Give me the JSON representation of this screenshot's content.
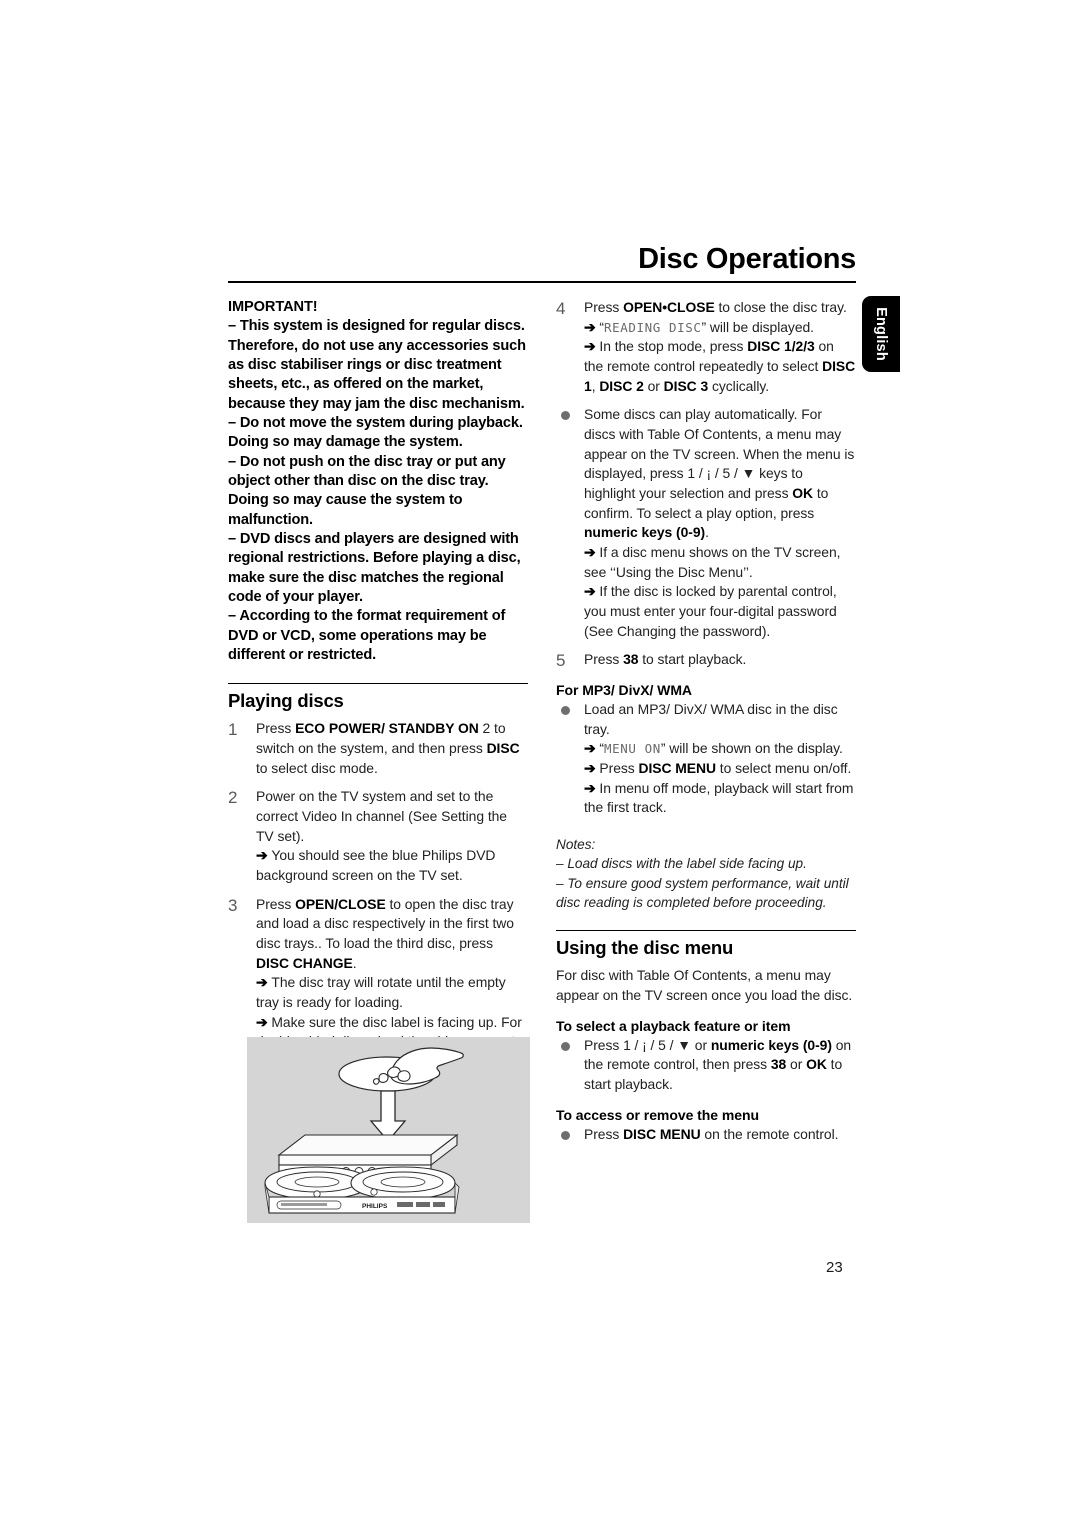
{
  "document": {
    "page_title": "Disc Operations",
    "language_tab": "English",
    "page_number": "23"
  },
  "left_column": {
    "important_heading": "IMPORTANT!",
    "important_items": [
      "This system is designed for regular discs. Therefore, do not use any accessories such as disc stabiliser rings or disc treatment sheets, etc., as offered on the market, because they may jam the disc mechanism.",
      "Do not move the system during playback. Doing so may damage the system.",
      "Do not push on the disc tray or put any object other than disc on the disc tray. Doing so may cause the system to malfunction.",
      "DVD discs and players are designed with regional restrictions. Before playing a disc, make sure the disc matches the regional code of your player.",
      "According to the format requirement of DVD or VCD, some operations may be different or restricted."
    ],
    "section_heading": "Playing discs",
    "steps": [
      {
        "number": "1",
        "parts": [
          {
            "t": "Press ",
            "s": "n"
          },
          {
            "t": "ECO POWER/ STANDBY ON",
            "s": "b"
          },
          {
            "t": " 2",
            "s": "n"
          },
          {
            "t": "  to switch on the system, and then press ",
            "s": "n"
          },
          {
            "t": "DISC",
            "s": "b"
          },
          {
            "t": " to select disc mode.",
            "s": "n"
          }
        ]
      },
      {
        "number": "2",
        "parts": [
          {
            "t": "Power on the TV system and set to the correct Video In channel (See Setting the TV set).",
            "s": "n"
          }
        ],
        "arrows": [
          [
            {
              "t": "You should see the blue Philips DVD background screen on the TV set.",
              "s": "n"
            }
          ]
        ]
      },
      {
        "number": "3",
        "parts": [
          {
            "t": "Press ",
            "s": "n"
          },
          {
            "t": "OPEN/CLOSE",
            "s": "b"
          },
          {
            "t": " to open the disc tray and load a disc respectively in the first two disc trays.. To load the third disc, press ",
            "s": "n"
          },
          {
            "t": "DISC CHANGE",
            "s": "b"
          },
          {
            "t": ".",
            "s": "n"
          }
        ],
        "arrows": [
          [
            {
              "t": "The disc tray will rotate until the empty tray is ready for loading.",
              "s": "n"
            }
          ],
          [
            {
              "t": "Make sure the disc label is facing up. For double-sided discs, load the side you want to play facing down.",
              "s": "n"
            }
          ]
        ]
      }
    ]
  },
  "right_column": {
    "steps": [
      {
        "number": "4",
        "parts": [
          {
            "t": "Press ",
            "s": "n"
          },
          {
            "t": "OPEN•CLOSE",
            "s": "b"
          },
          {
            "t": " to close the disc tray.",
            "s": "n"
          }
        ],
        "arrows": [
          [
            {
              "t": "“",
              "s": "n"
            },
            {
              "t": "READING DISC",
              "s": "lcd"
            },
            {
              "t": "” will be displayed.",
              "s": "n"
            }
          ],
          [
            {
              "t": "In the stop mode, press ",
              "s": "n"
            },
            {
              "t": "DISC 1/2/3",
              "s": "b"
            },
            {
              "t": " on the remote control repeatedly to select ",
              "s": "n"
            },
            {
              "t": "DISC 1",
              "s": "b"
            },
            {
              "t": ", ",
              "s": "n"
            },
            {
              "t": "DISC 2",
              "s": "b"
            },
            {
              "t": " or ",
              "s": "n"
            },
            {
              "t": "DISC 3",
              "s": "b"
            },
            {
              "t": " cyclically.",
              "s": "n"
            }
          ]
        ]
      }
    ],
    "auto_play_bullet": {
      "parts": [
        {
          "t": "Some discs can play automatically. For discs with Table Of Contents, a menu may appear on the TV screen. When the menu is displayed, press 1    / ¡    / 5  / ▼ keys to highlight your selection and press ",
          "s": "n"
        },
        {
          "t": "OK",
          "s": "b"
        },
        {
          "t": " to confirm. To select a play option, press ",
          "s": "n"
        },
        {
          "t": "numeric keys (0-9)",
          "s": "b"
        },
        {
          "t": ".",
          "s": "n"
        }
      ],
      "arrows": [
        [
          {
            "t": "If a disc menu shows on the TV screen, see ‘‘Using the Disc Menu’’.",
            "s": "n"
          }
        ],
        [
          {
            "t": "If the disc is locked by parental control, you must enter your four-digital password (See Changing the password).",
            "s": "n"
          }
        ]
      ]
    },
    "step5": {
      "number": "5",
      "parts": [
        {
          "t": "Press ",
          "s": "n"
        },
        {
          "t": "38",
          "s": "b"
        },
        {
          "t": "  to start playback.",
          "s": "n"
        }
      ]
    },
    "mp3_heading": "For MP3/ DivX/ WMA",
    "mp3_bullet": {
      "parts": [
        {
          "t": "Load an MP3/ DivX/ WMA disc in the disc tray.",
          "s": "n"
        }
      ],
      "arrows": [
        [
          {
            "t": "“",
            "s": "n"
          },
          {
            "t": "MENU ON",
            "s": "lcd"
          },
          {
            "t": "”  will be shown on the display.",
            "s": "n"
          }
        ],
        [
          {
            "t": "Press ",
            "s": "n"
          },
          {
            "t": "DISC MENU",
            "s": "b"
          },
          {
            "t": " to select menu on/off.",
            "s": "n"
          }
        ],
        [
          {
            "t": "In menu off mode, playback will start from the first track.",
            "s": "n"
          }
        ]
      ]
    },
    "notes_heading": "Notes:",
    "notes": [
      "Load discs with the label side facing up.",
      "To ensure good system performance, wait until disc reading is completed before proceeding."
    ],
    "disc_menu_heading": "Using the disc menu",
    "disc_menu_intro": "For disc with Table Of Contents, a menu may appear on the TV screen once you load the disc.",
    "playback_feature_heading": "To select a playback feature or item",
    "playback_feature_bullet": {
      "parts": [
        {
          "t": "Press 1     / ¡      / 5  / ▼ or ",
          "s": "n"
        },
        {
          "t": "numeric keys (0-9)",
          "s": "b"
        },
        {
          "t": " on the remote control, then press ",
          "s": "n"
        },
        {
          "t": "38",
          "s": "b"
        },
        {
          "t": "  or ",
          "s": "n"
        },
        {
          "t": "OK",
          "s": "b"
        },
        {
          "t": " to start playback.",
          "s": "n"
        }
      ]
    },
    "access_menu_heading": "To access or remove the menu",
    "access_menu_bullet": {
      "parts": [
        {
          "t": "Press ",
          "s": "n"
        },
        {
          "t": "DISC MENU",
          "s": "b"
        },
        {
          "t": " on the remote control.",
          "s": "n"
        }
      ]
    }
  },
  "illustration": {
    "caption_alt": "Hand loading a disc into the open tray of a 3-disc DVD player",
    "brand_label": "PHILIPS",
    "background_color": "#d5d5d5"
  }
}
